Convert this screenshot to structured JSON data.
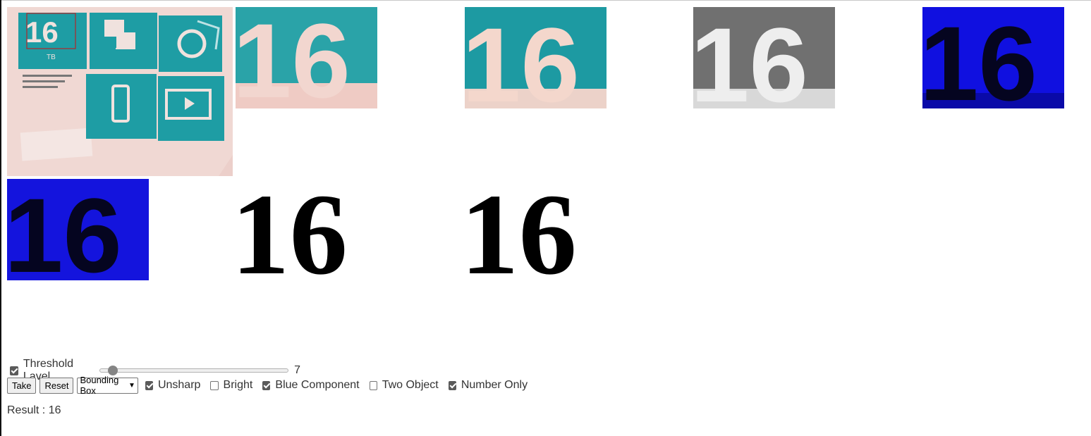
{
  "images": [
    {
      "name": "original-photo",
      "content": "photo of packaging with tiles: 16 TB, backup, iOS android, HD streaming"
    },
    {
      "name": "crop-1",
      "text": "16",
      "bg": "#2aa3a8",
      "fg": "#f2d6cf"
    },
    {
      "name": "crop-2",
      "text": "16",
      "bg": "#1d9aa2",
      "fg": "#f4d7cc"
    },
    {
      "name": "crop-3",
      "text": "16",
      "bg": "#707070",
      "fg": "#eeeeee"
    },
    {
      "name": "crop-4",
      "text": "16",
      "bg": "#1010e0",
      "fg": "#050520"
    },
    {
      "name": "crop-5",
      "text": "16",
      "bg": "#1414dd",
      "fg": "#050520"
    },
    {
      "name": "binary-1",
      "text": "16",
      "bg": "#ffffff",
      "fg": "#000000"
    },
    {
      "name": "binary-2",
      "text": "16",
      "bg": "#ffffff",
      "fg": "#000000"
    }
  ],
  "controls": {
    "threshold": {
      "label": "Threshold Lavel",
      "checked": true,
      "value": "7",
      "fraction": 0.04
    },
    "take_label": "Take",
    "reset_label": "Reset",
    "mode_select": {
      "value": "Bounding Box"
    },
    "options": [
      {
        "label": "Unsharp",
        "checked": true
      },
      {
        "label": "Bright",
        "checked": false
      },
      {
        "label": "Blue Component",
        "checked": true
      },
      {
        "label": "Two Object",
        "checked": false
      },
      {
        "label": "Number Only",
        "checked": true
      }
    ]
  },
  "result": {
    "label": "Result :",
    "value": "16"
  }
}
